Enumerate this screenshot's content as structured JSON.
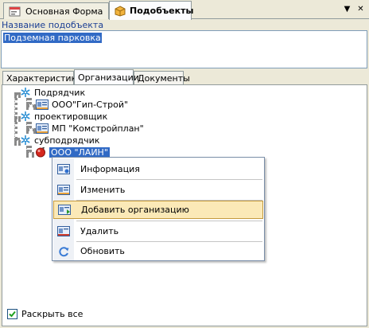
{
  "doc_tabs": [
    {
      "label": "Основная Форма",
      "icon": "form-icon"
    },
    {
      "label": "Подобъекты",
      "icon": "box-icon"
    }
  ],
  "window_buttons": {
    "menu": "▼",
    "close": "✕"
  },
  "name_label": "Название подобъекта",
  "name_value": "Подземная парковка",
  "inner_tabs": [
    "Характеристика",
    "Организации",
    "Документы"
  ],
  "tree": {
    "groups": [
      {
        "label": "Подрядчик",
        "child": "ООО\"Гип-Строй\""
      },
      {
        "label": "проектировщик",
        "child": "МП \"Комстройплан\""
      },
      {
        "label": "субподрядчик",
        "child": "ООО \"ЛАИН\""
      }
    ]
  },
  "context_menu": [
    "Информация",
    "Изменить",
    "Добавить организацию",
    "Удалить",
    "Обновить"
  ],
  "expand_all_label": "Раскрыть все",
  "expand_all_checked": true,
  "colors": {
    "selection": "#316ac5",
    "menu_hover": "#fbe9b7",
    "label_blue": "#1c3f94"
  }
}
